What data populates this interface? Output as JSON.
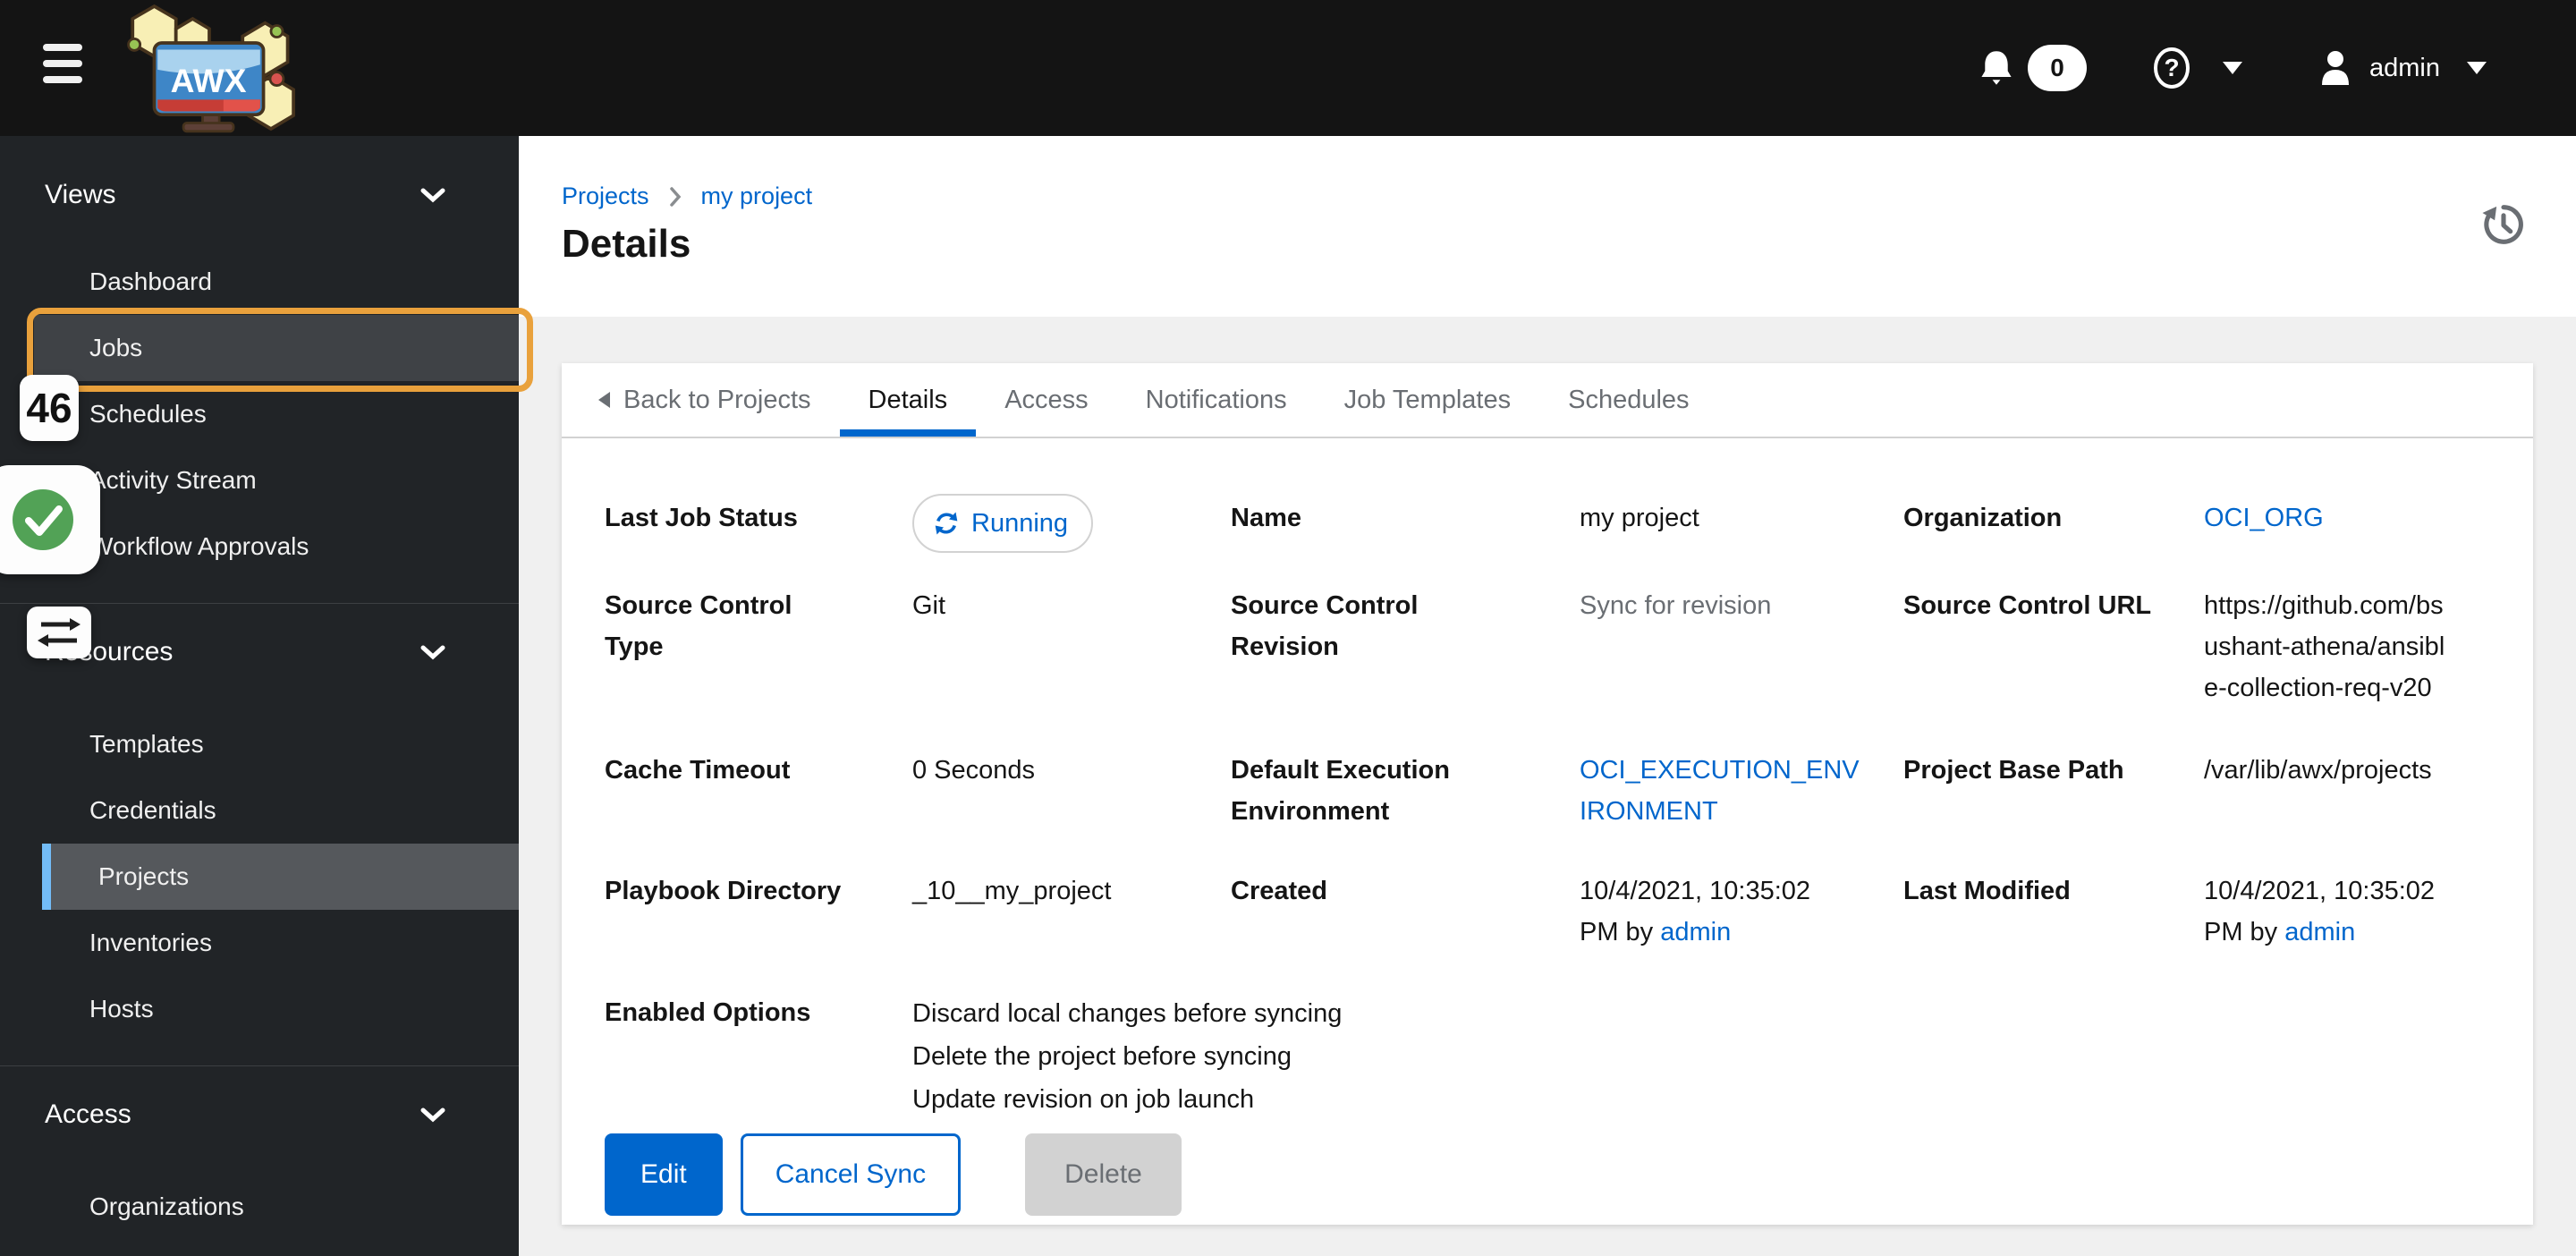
{
  "masthead": {
    "notification_count": "0",
    "username": "admin",
    "logo_text": "AWX"
  },
  "sidebar": {
    "groups": [
      {
        "label": "Views",
        "items": [
          "Dashboard",
          "Jobs",
          "Schedules",
          "Activity Stream",
          "Workflow Approvals"
        ]
      },
      {
        "label": "Resources",
        "items": [
          "Templates",
          "Credentials",
          "Projects",
          "Inventories",
          "Hosts"
        ]
      },
      {
        "label": "Access",
        "items": [
          "Organizations"
        ]
      }
    ],
    "selected_item": "Projects",
    "highlighted_item": "Jobs"
  },
  "annotations": {
    "step_number": "46",
    "highlight_color": "#e9a13c",
    "check_color": "#52a256"
  },
  "header": {
    "breadcrumb": [
      "Projects",
      "my project"
    ],
    "title": "Details"
  },
  "tabs": {
    "back_label": "Back to Projects",
    "items": [
      "Details",
      "Access",
      "Notifications",
      "Job Templates",
      "Schedules"
    ],
    "active": "Details"
  },
  "details": {
    "last_job_status": {
      "label": "Last Job Status",
      "value": "Running"
    },
    "name": {
      "label": "Name",
      "value": "my project"
    },
    "organization": {
      "label": "Organization",
      "value": "OCI_ORG"
    },
    "source_control_type": {
      "label": "Source Control Type",
      "value": "Git"
    },
    "source_control_revision": {
      "label": "Source Control Revision",
      "value": "Sync for revision"
    },
    "source_control_url": {
      "label": "Source Control URL",
      "value": "https://github.com/bsushant-athena/ansible-collection-req-v20"
    },
    "cache_timeout": {
      "label": "Cache Timeout",
      "value": "0 Seconds"
    },
    "default_execution_environment": {
      "label": "Default Execution Environment",
      "value": "OCI_EXECUTION_ENVIRONMENT"
    },
    "project_base_path": {
      "label": "Project Base Path",
      "value": "/var/lib/awx/projects"
    },
    "playbook_directory": {
      "label": "Playbook Directory",
      "value": "_10__my_project"
    },
    "created": {
      "label": "Created",
      "value_prefix": "10/4/2021, 10:35:02 PM by ",
      "link": "admin"
    },
    "last_modified": {
      "label": "Last Modified",
      "value_prefix": "10/4/2021, 10:35:02 PM by ",
      "link": "admin"
    },
    "enabled_options": {
      "label": "Enabled Options",
      "items": [
        "Discard local changes before syncing",
        "Delete the project before syncing",
        "Update revision on job launch"
      ]
    }
  },
  "actions": {
    "edit": "Edit",
    "cancel_sync": "Cancel Sync",
    "delete": "Delete"
  },
  "colors": {
    "accent_blue": "#0066cc",
    "masthead_bg": "#141414",
    "sidebar_bg": "#212427",
    "selected_bar": "#73bcf7",
    "annotation_orange": "#e9a13c",
    "page_bg": "#f0f0f0"
  }
}
